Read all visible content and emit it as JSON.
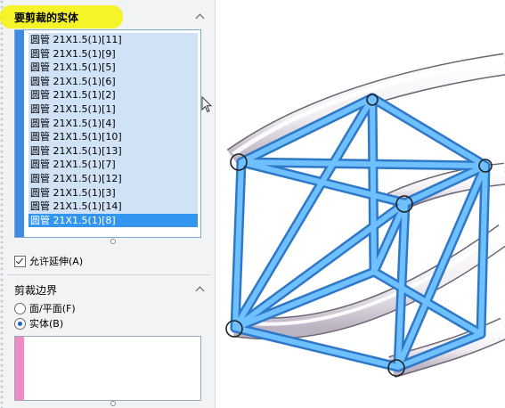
{
  "bodies_section": {
    "title": "要剪裁的实体",
    "items": [
      "圆管 21X1.5(1)[11]",
      "圆管 21X1.5(1)[9]",
      "圆管 21X1.5(1)[5]",
      "圆管 21X1.5(1)[6]",
      "圆管 21X1.5(1)[2]",
      "圆管 21X1.5(1)[1]",
      "圆管 21X1.5(1)[4]",
      "圆管 21X1.5(1)[10]",
      "圆管 21X1.5(1)[13]",
      "圆管 21X1.5(1)[7]",
      "圆管 21X1.5(1)[12]",
      "圆管 21X1.5(1)[3]",
      "圆管 21X1.5(1)[14]",
      "圆管 21X1.5(1)[8]"
    ],
    "selected_index": 13,
    "allow_extend_label": "允许延伸(A)",
    "allow_extend_checked": true
  },
  "trim_boundary": {
    "title": "剪裁边界",
    "option_face_plane": "面/平面(F)",
    "option_body": "实体(B)",
    "selected_option": "body"
  },
  "colors": {
    "highlight": "#f6f205",
    "selection": "#3296f0",
    "member_blue": "#4aa3f2",
    "pink_strip": "#f28ac6"
  }
}
